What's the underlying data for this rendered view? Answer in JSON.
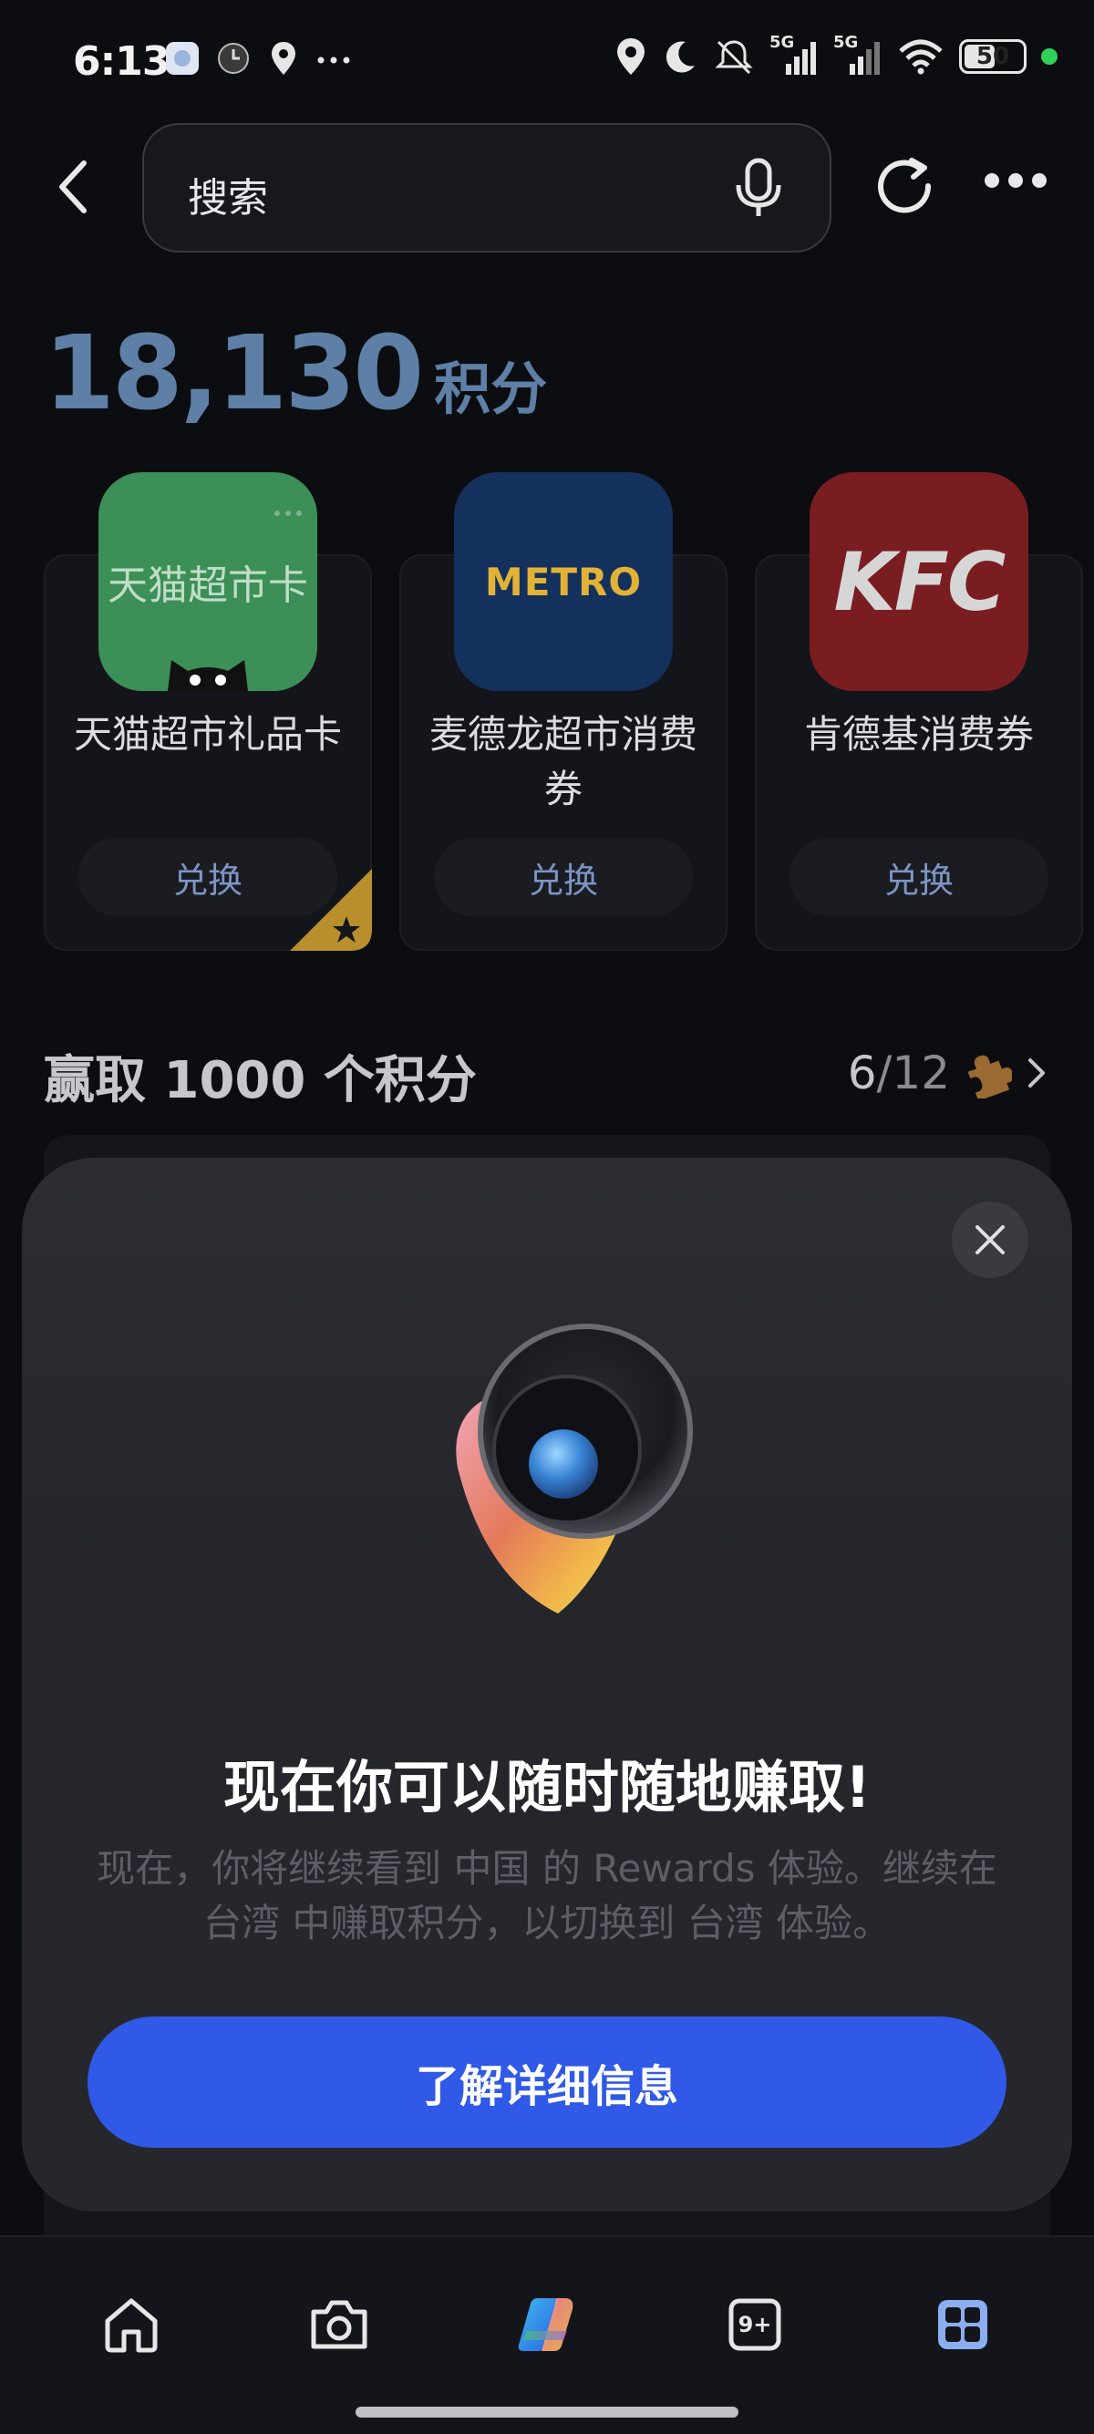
{
  "status_bar": {
    "time": "6:13",
    "battery": "50",
    "network_1": "5G",
    "network_2": "5G"
  },
  "header": {
    "search_placeholder": "搜索"
  },
  "points": {
    "value": "18,130",
    "unit": "积分"
  },
  "rewards": [
    {
      "title": "天猫超市礼品卡",
      "logo_text": "天猫超市卡",
      "button": "兑换",
      "color": "#3c8f56"
    },
    {
      "title": "麦德龙超市消费券",
      "logo_text": "METRO",
      "button": "兑换",
      "color": "#14305c"
    },
    {
      "title": "肯德基消费券",
      "logo_text": "KFC",
      "button": "兑换",
      "color": "#7a1d21"
    }
  ],
  "earn_section": {
    "title": "赢取 1000 个积分",
    "progress_done": "6",
    "progress_total": "/12"
  },
  "modal": {
    "title": "现在你可以随时随地赚取!",
    "description": "现在，你将继续看到 中国 的 Rewards 体验。继续在 台湾 中赚取积分，以切换到 台湾 体验。",
    "cta": "了解详细信息"
  },
  "bottom_nav": {
    "tabs_badge": "9+",
    "items": [
      "home-icon",
      "camera-icon",
      "copilot-icon",
      "tabs-icon",
      "apps-icon"
    ]
  },
  "colors": {
    "accent": "#2f59e6",
    "points": "#5e7fa6"
  }
}
